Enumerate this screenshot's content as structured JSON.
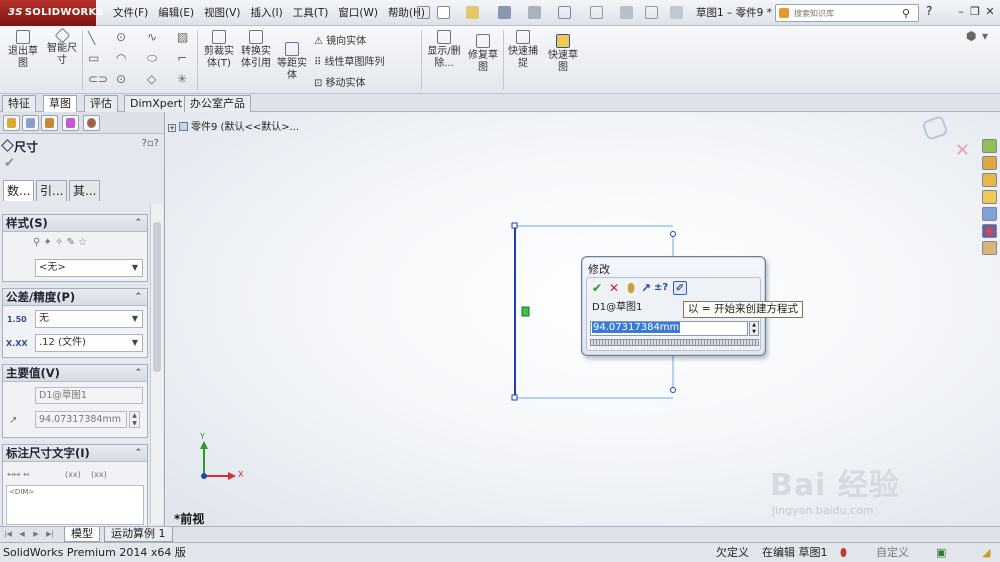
{
  "app": {
    "logo": "SOLIDWORKS",
    "menus": [
      "文件(F)",
      "编辑(E)",
      "视图(V)",
      "插入(I)",
      "工具(T)",
      "窗口(W)",
      "帮助(H)"
    ],
    "document_title": "草图1 – 零件9 *",
    "search_placeholder": "搜索知识库"
  },
  "ribbon": {
    "exit_sketch": "退出草图",
    "smart_dimension": "智能尺寸",
    "trim": "剪裁实体(T)",
    "convert": "转换实体引用",
    "offset": "等距实体",
    "mirror": "镜向实体",
    "linear_pattern": "线性草图阵列",
    "move": "移动实体",
    "show_delete": "显示/删除...",
    "repair": "修复草图",
    "quick_snap": "快速捕捉",
    "rapid_sketch": "快速草图"
  },
  "tabs": [
    "特征",
    "草图",
    "评估",
    "DimXpert",
    "办公室产品"
  ],
  "active_tab": "草图",
  "property_manager": {
    "title": "尺寸",
    "sub_tabs": [
      "数...",
      "引...",
      "其..."
    ],
    "style": {
      "header": "样式(S)",
      "value": "<无>"
    },
    "tolerance": {
      "header": "公差/精度(P)",
      "tolerance_type": "无",
      "precision": ".12 (文件)",
      "tolerance_icon": "1.50",
      "precision_icon": "X.XX"
    },
    "primary_value": {
      "header": "主要值(V)",
      "name": "D1@草图1",
      "value": "94.07317384mm"
    },
    "dimension_text": {
      "header": "标注尺寸文字(I)",
      "token": "<DIM>",
      "paren": "(xx)",
      "basic": "(xx)"
    }
  },
  "viewport": {
    "tree_root": "零件9  (默认<<默认>...",
    "view_name": "*前视",
    "axis_x": "X",
    "axis_y": "Y"
  },
  "modify_dialog": {
    "title": "修改",
    "dim_name": "D1@草图1",
    "value": "94.07317384mm",
    "tooltip": "以 = 开始来创建方程式"
  },
  "bottom_tabs": [
    "模型",
    "运动算例 1"
  ],
  "status": {
    "product": "SolidWorks Premium 2014 x64 版",
    "sketch_state": "欠定义",
    "editing": "在编辑 草图1",
    "custom": "自定义"
  },
  "watermark": {
    "main": "Bai 经验",
    "sub": "jingyan.baidu.com"
  },
  "colors": {
    "accent": "#3a7bd5",
    "sketch_line": "#1b3fb0",
    "logo_red": "#a3211c"
  }
}
